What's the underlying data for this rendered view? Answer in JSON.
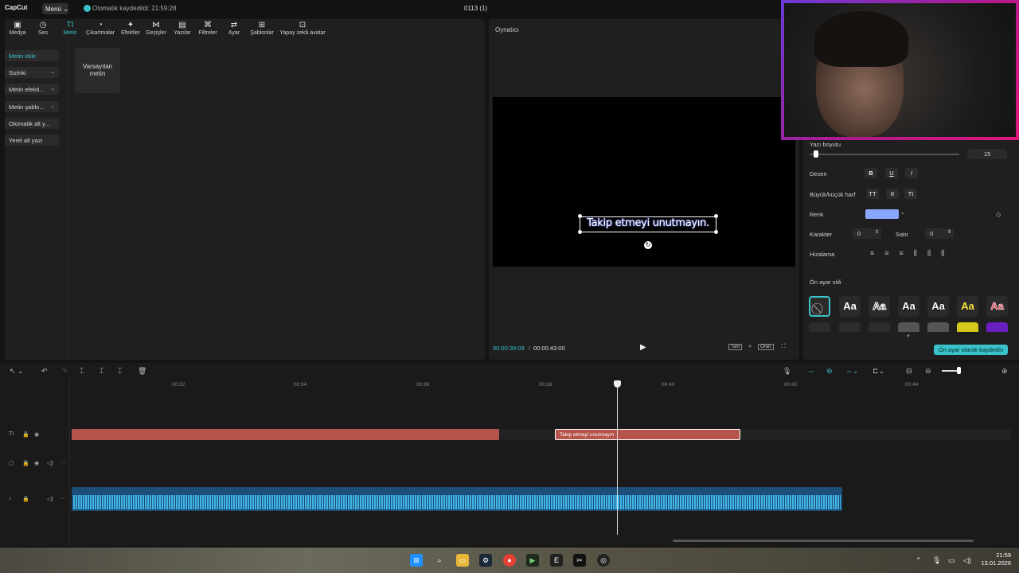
{
  "topbar": {
    "logo": "CapCut",
    "menu_label": "Menü",
    "autosave": "Otomatik kaydedildi: 21:59:28",
    "project_title": "0113 (1)"
  },
  "toolbar": [
    {
      "label": "Medya",
      "icon": "media-icon"
    },
    {
      "label": "Ses",
      "icon": "audio-icon"
    },
    {
      "label": "Metin",
      "icon": "text-icon"
    },
    {
      "label": "Çıkartmalar",
      "icon": "sticker-icon"
    },
    {
      "label": "Efektler",
      "icon": "effects-icon"
    },
    {
      "label": "Geçişler",
      "icon": "transitions-icon"
    },
    {
      "label": "Yazılar",
      "icon": "captions-icon"
    },
    {
      "label": "Filtreler",
      "icon": "filters-icon"
    },
    {
      "label": "Ayar",
      "icon": "adjust-icon"
    },
    {
      "label": "Şablonlar",
      "icon": "templates-icon"
    },
    {
      "label": "Yapay zekâ avatar",
      "icon": "ai-avatar-icon"
    }
  ],
  "sidebar": [
    {
      "label": "Metin ekle"
    },
    {
      "label": "Sizinki"
    },
    {
      "label": "Metin efekti..."
    },
    {
      "label": "Metin şablo..."
    },
    {
      "label": "Otomatik alt y..."
    },
    {
      "label": "Yerel alt yazı"
    }
  ],
  "default_text_card": "Varsayılan metin",
  "player": {
    "title": "Oynatıcı",
    "caption": "Takip etmeyi unutmayın.",
    "time_current": "00:00:39:09",
    "time_separator": "/",
    "time_total": "00:00:43:00",
    "ctrl_fit": "Tam",
    "ctrl_ratio": "Oran"
  },
  "right_panel": {
    "font_size_label": "Yazı boyutu",
    "font_size_value": "15",
    "font_size_fraction": 0.04,
    "pattern_label": "Desen",
    "pattern_buttons": [
      "B",
      "U",
      "I"
    ],
    "case_label": "Büyük/küçük harf",
    "case_buttons": [
      "TT",
      "tt",
      "Tt"
    ],
    "color_label": "Renk",
    "color_value": "#8aa7ff",
    "character_label": "Karakter",
    "character_value": "0",
    "line_label": "Satır",
    "line_value": "0",
    "align_label": "Hizalama",
    "preset_style_label": "Ön ayar stili",
    "preset_glyph": "Aa",
    "save_preset_button": "Ön ayar olarak kaydedin"
  },
  "timeline": {
    "ruler": [
      "00:32",
      "00:34",
      "00:36",
      "00:38",
      "00:40",
      "00:42",
      "00:44"
    ],
    "text_clip_label": "Takip etmeyi unutmayın"
  },
  "taskbar": {
    "time": "21:59",
    "date": "13.01.2026"
  },
  "colors": {
    "accent": "#39c2c9",
    "clip": "#b5544a",
    "audio": "#1c4e77",
    "waveform": "#42b6e8"
  }
}
